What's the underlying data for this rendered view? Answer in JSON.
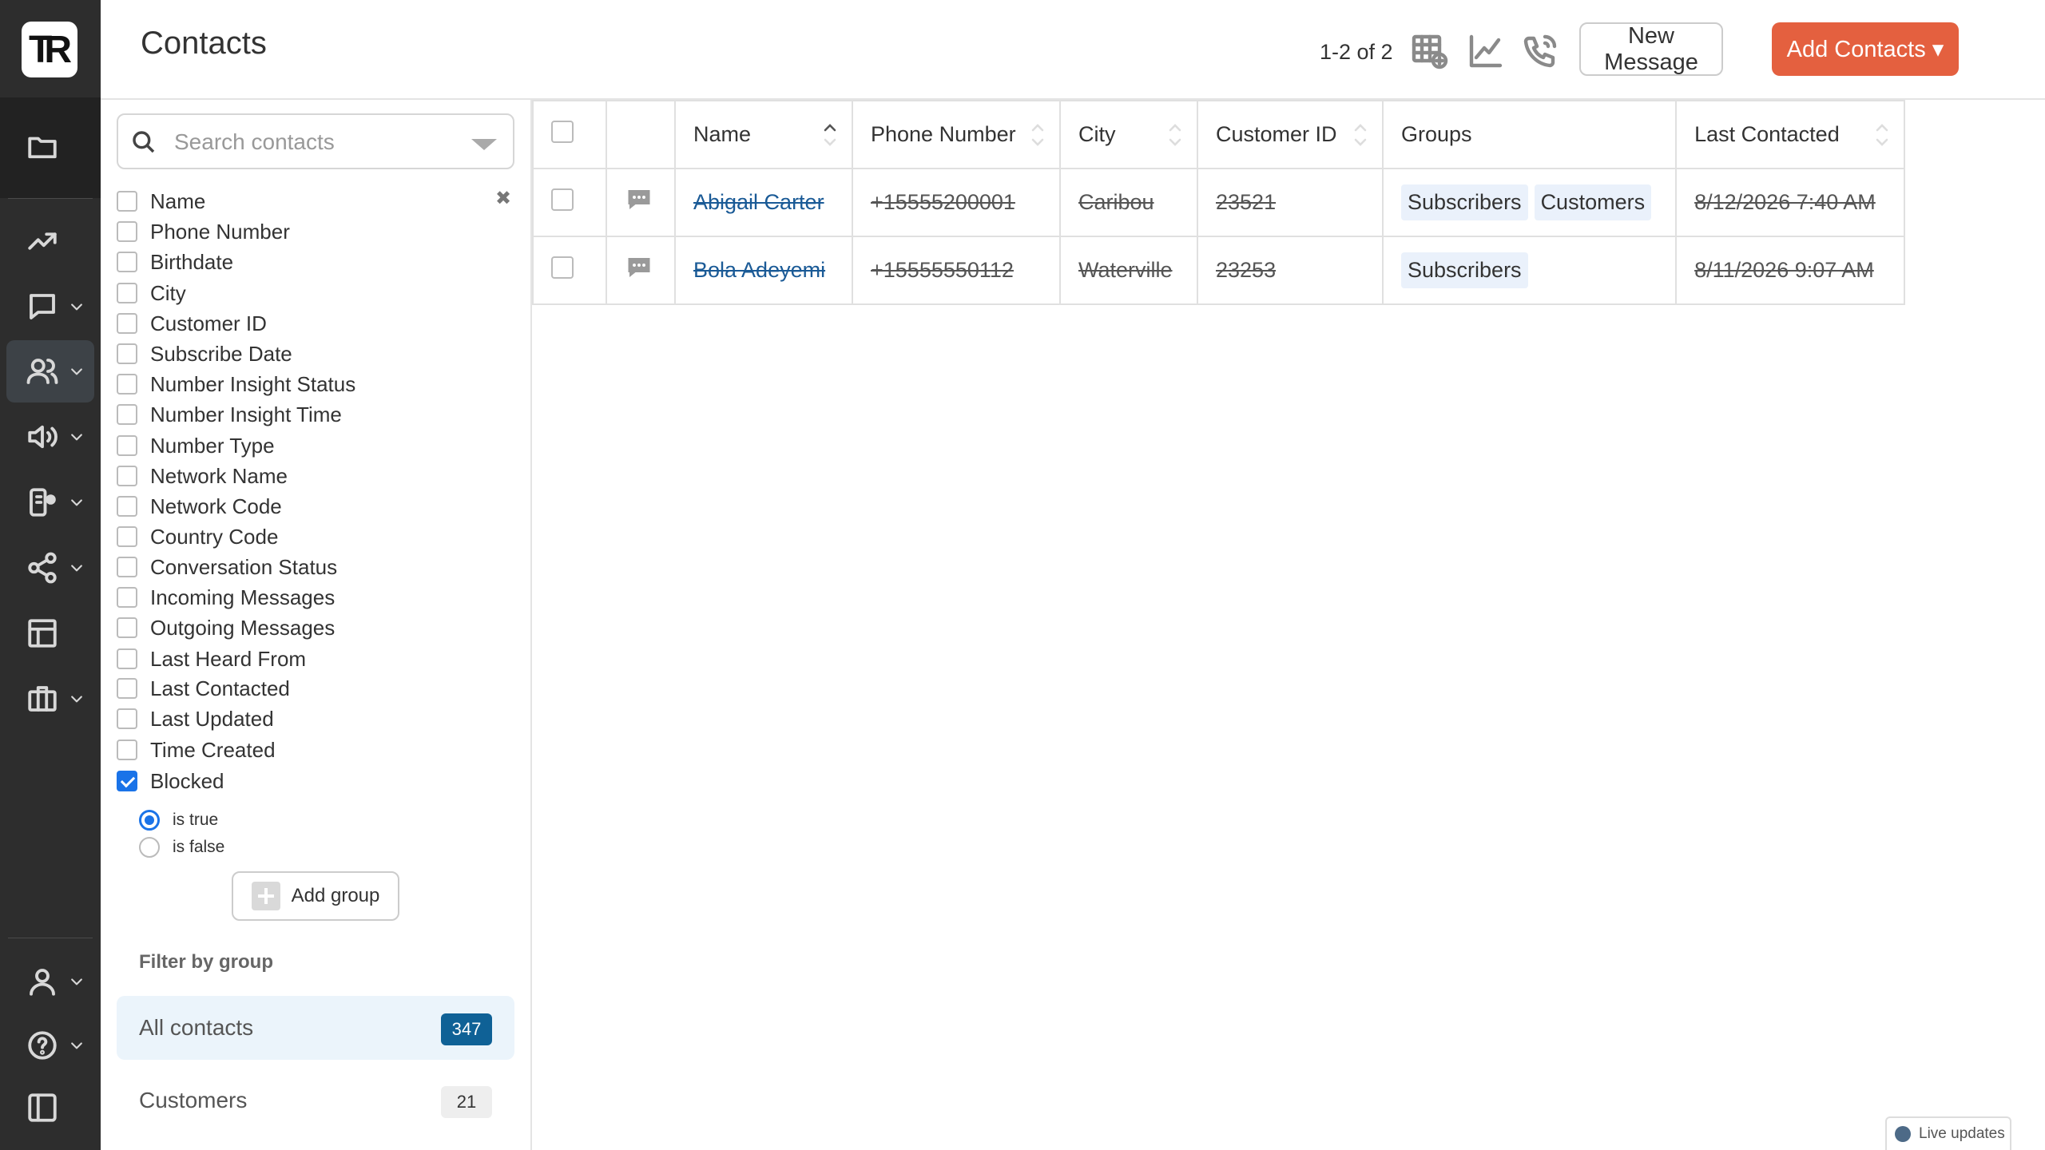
{
  "app": {
    "logo_text": "TR"
  },
  "header": {
    "title": "Contacts",
    "count": "1-2 of 2",
    "new_message_label": "New Message",
    "add_contacts_label": "Add Contacts ▾"
  },
  "sidebar": {
    "items": [
      {
        "name": "folder-icon"
      },
      {
        "name": "trending-icon"
      },
      {
        "name": "chat-icon"
      },
      {
        "name": "users-icon",
        "active": true
      },
      {
        "name": "megaphone-icon"
      },
      {
        "name": "automation-icon"
      },
      {
        "name": "share-icon"
      },
      {
        "name": "table-icon"
      },
      {
        "name": "briefcase-icon"
      },
      {
        "name": "user-icon"
      },
      {
        "name": "help-icon"
      },
      {
        "name": "panel-toggle-icon"
      }
    ]
  },
  "filters": {
    "search_placeholder": "Search contacts",
    "fields": [
      {
        "label": "Name",
        "checked": false
      },
      {
        "label": "Phone Number",
        "checked": false
      },
      {
        "label": "Birthdate",
        "checked": false
      },
      {
        "label": "City",
        "checked": false
      },
      {
        "label": "Customer ID",
        "checked": false
      },
      {
        "label": "Subscribe Date",
        "checked": false
      },
      {
        "label": "Number Insight Status",
        "checked": false
      },
      {
        "label": "Number Insight Time",
        "checked": false
      },
      {
        "label": "Number Type",
        "checked": false
      },
      {
        "label": "Network Name",
        "checked": false
      },
      {
        "label": "Network Code",
        "checked": false
      },
      {
        "label": "Country Code",
        "checked": false
      },
      {
        "label": "Conversation Status",
        "checked": false
      },
      {
        "label": "Incoming Messages",
        "checked": false
      },
      {
        "label": "Outgoing Messages",
        "checked": false
      },
      {
        "label": "Last Heard From",
        "checked": false
      },
      {
        "label": "Last Contacted",
        "checked": false
      },
      {
        "label": "Last Updated",
        "checked": false
      },
      {
        "label": "Time Created",
        "checked": false
      },
      {
        "label": "Blocked",
        "checked": true
      }
    ],
    "blocked_options": [
      {
        "label": "is true",
        "selected": true
      },
      {
        "label": "is false",
        "selected": false
      }
    ],
    "add_group_label": "Add group",
    "filter_by_group_label": "Filter by group",
    "groups": [
      {
        "label": "All contacts",
        "count": "347",
        "selected": true
      },
      {
        "label": "Customers",
        "count": "21",
        "selected": false
      }
    ]
  },
  "table": {
    "columns": [
      "Name",
      "Phone Number",
      "City",
      "Customer ID",
      "Groups",
      "Last Contacted"
    ],
    "rows": [
      {
        "name": "Abigail Carter",
        "phone": "+15555200001",
        "city": "Caribou",
        "customer_id": "23521",
        "groups": [
          "Subscribers",
          "Customers"
        ],
        "last_contacted": "8/12/2026 7:40 AM"
      },
      {
        "name": "Bola Adeyemi",
        "phone": "+15555550112",
        "city": "Waterville",
        "customer_id": "23253",
        "groups": [
          "Subscribers"
        ],
        "last_contacted": "8/11/2026 9:07 AM"
      }
    ]
  },
  "footer": {
    "live_updates_label": "Live updates"
  },
  "colors": {
    "accent": "#e4603f",
    "sidebar_bg": "#2d2d2d",
    "link": "#1a5a96",
    "badge": "#0f6196",
    "check": "#1a73e8"
  }
}
